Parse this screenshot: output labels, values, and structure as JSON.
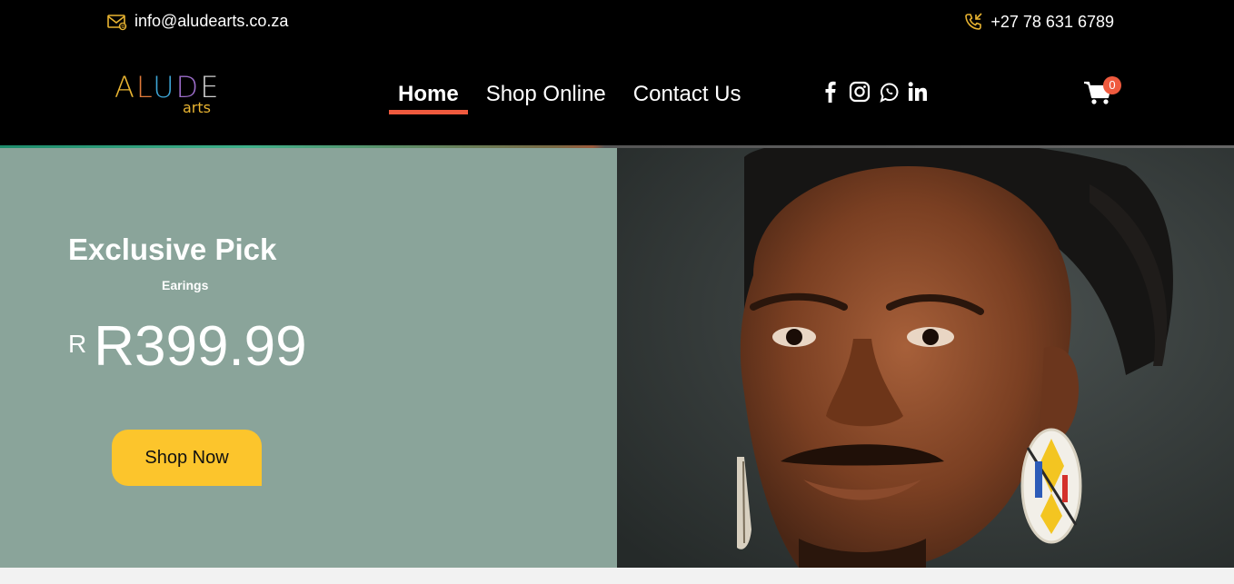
{
  "topbar": {
    "email": "info@aludearts.co.za",
    "email_icon": "mail-icon",
    "phone": "+27 78 631 6789",
    "phone_icon": "phone-icon",
    "icon_color": "#e9b431"
  },
  "logo": {
    "main": "ALUDE",
    "sub": "arts",
    "letter_colors": [
      "#e9b431",
      "#e07a3a",
      "#3ea7d8",
      "#9b6cc8",
      "#cfcfcf"
    ]
  },
  "nav": {
    "items": [
      {
        "label": "Home",
        "active": true
      },
      {
        "label": "Shop Online",
        "active": false
      },
      {
        "label": "Contact Us",
        "active": false
      }
    ],
    "accent": "#ef5a3e"
  },
  "social": [
    "facebook-icon",
    "instagram-icon",
    "whatsapp-icon",
    "linkedin-icon"
  ],
  "cart": {
    "icon": "cart-icon",
    "count": "0"
  },
  "hero": {
    "title": "Exclusive Pick",
    "subtitle": "Earings",
    "currency": "R",
    "price": "R399.99",
    "button_label": "Shop Now",
    "bg_color": "#8aa49a",
    "button_color": "#fcc52c"
  }
}
